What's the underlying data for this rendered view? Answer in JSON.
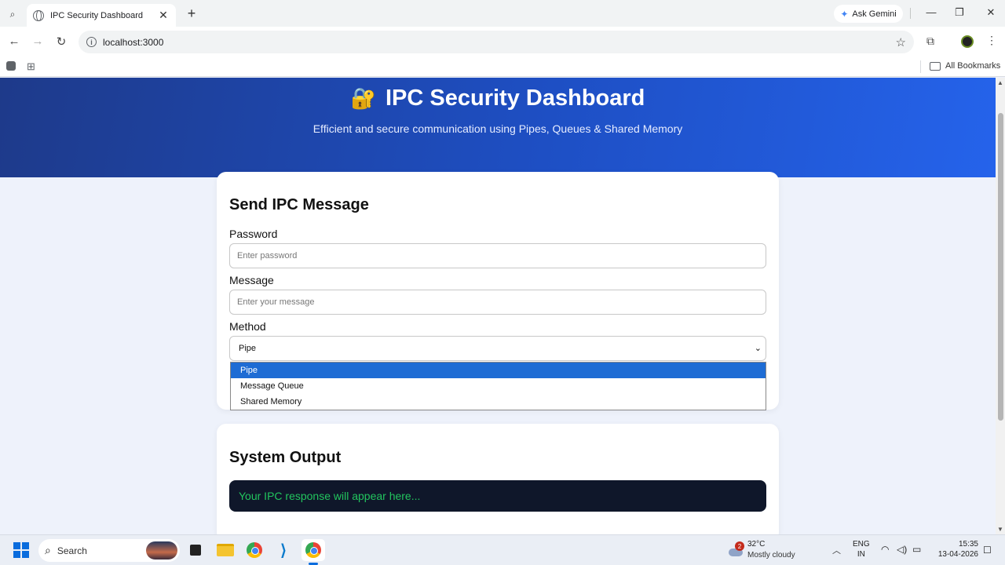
{
  "browser": {
    "tab_title": "IPC Security Dashboard",
    "new_tab": "+",
    "tab_close": "✕",
    "gemini_label": "Ask Gemini",
    "url": "localhost:3000",
    "all_bookmarks": "All Bookmarks"
  },
  "hero": {
    "icon": "🔐",
    "title": "IPC Security Dashboard",
    "subtitle": "Efficient and secure communication using Pipes, Queues & Shared Memory"
  },
  "send_card": {
    "heading": "Send IPC Message",
    "password_label": "Password",
    "password_placeholder": "Enter password",
    "message_label": "Message",
    "message_placeholder": "Enter your message",
    "method_label": "Method",
    "method_selected": "Pipe",
    "method_options": [
      "Pipe",
      "Message Queue",
      "Shared Memory"
    ]
  },
  "output_card": {
    "heading": "System Output",
    "console_text": "Your IPC response will appear here..."
  },
  "taskbar": {
    "search_label": "Search",
    "weather_badge": "2",
    "weather_temp": "32°C",
    "weather_desc": "Mostly cloudy",
    "lang_line1": "ENG",
    "lang_line2": "IN",
    "time": "15:35",
    "date": "13-04-2026"
  },
  "colors": {
    "hero_start": "#1e3a8a",
    "hero_end": "#2563eb",
    "option_highlight": "#1e6cd4",
    "console_bg": "#0f172a",
    "console_text": "#22c55e"
  }
}
